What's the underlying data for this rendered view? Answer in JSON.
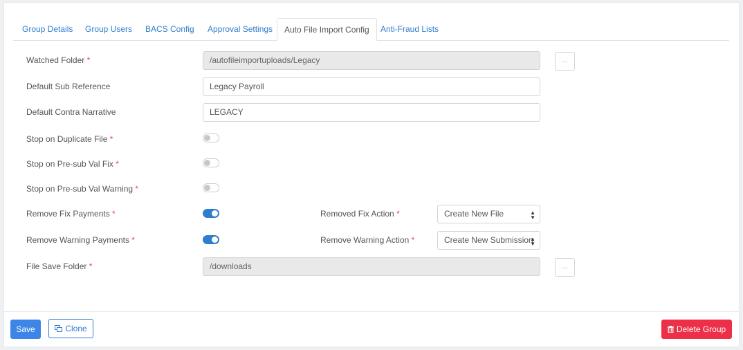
{
  "tabs": [
    {
      "label": "Group Details"
    },
    {
      "label": "Group Users"
    },
    {
      "label": "BACS Config"
    },
    {
      "label": "Approval Settings"
    },
    {
      "label": "Auto File Import Config",
      "active": true
    },
    {
      "label": "Anti-Fraud Lists"
    }
  ],
  "form": {
    "watched_folder": {
      "label": "Watched Folder",
      "value": "/autofileimportuploads/Legacy",
      "browse": "..."
    },
    "default_sub_reference": {
      "label": "Default Sub Reference",
      "value": "Legacy Payroll"
    },
    "default_contra_narrative": {
      "label": "Default Contra Narrative",
      "value": "LEGACY"
    },
    "stop_on_duplicate_file": {
      "label": "Stop on Duplicate File",
      "on": false
    },
    "stop_on_presub_val_fix": {
      "label": "Stop on Pre-sub Val Fix",
      "on": false
    },
    "stop_on_presub_val_warning": {
      "label": "Stop on Pre-sub Val Warning",
      "on": false
    },
    "remove_fix_payments": {
      "label": "Remove Fix Payments",
      "on": true
    },
    "removed_fix_action": {
      "label": "Removed Fix Action",
      "value": "Create New File"
    },
    "remove_warning_payments": {
      "label": "Remove Warning Payments",
      "on": true
    },
    "remove_warning_action": {
      "label": "Remove Warning Action",
      "value": "Create New Submission"
    },
    "file_save_folder": {
      "label": "File Save Folder",
      "value": "/downloads",
      "browse": "..."
    },
    "required_marker": "*"
  },
  "footer": {
    "save_label": "Save",
    "clone_label": "Clone",
    "delete_label": "Delete Group"
  },
  "colors": {
    "accent": "#2f7dce",
    "save": "#3d86e8",
    "danger": "#ed2f47",
    "required": "#e24b4b"
  }
}
